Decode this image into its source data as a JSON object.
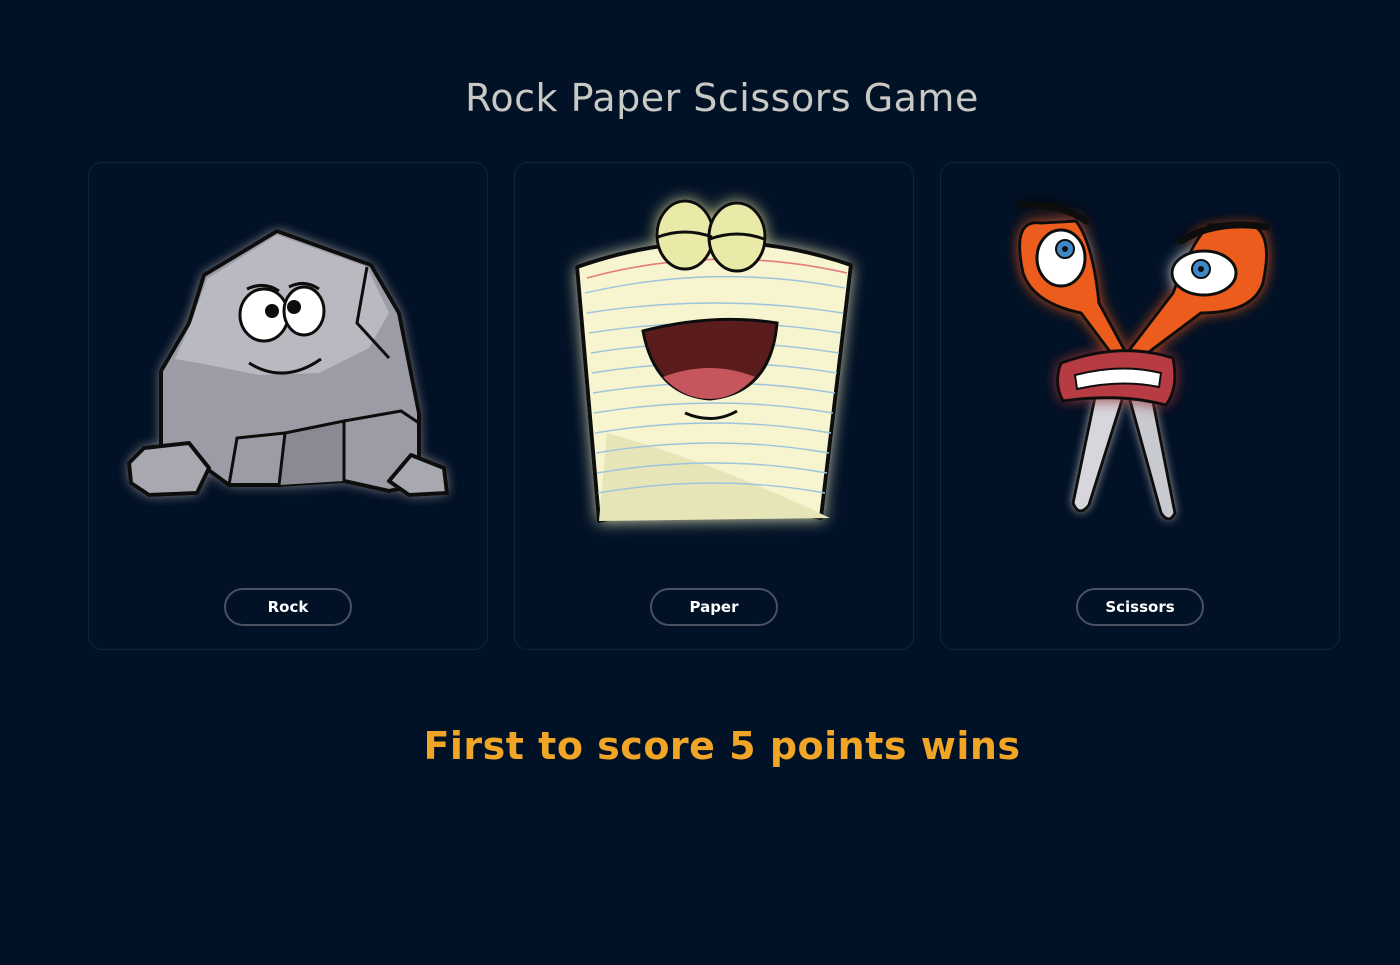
{
  "header": {
    "title": "Rock Paper Scissors Game"
  },
  "choices": [
    {
      "id": "rock",
      "label": "Rock",
      "icon": "rock-character-icon"
    },
    {
      "id": "paper",
      "label": "Paper",
      "icon": "paper-character-icon"
    },
    {
      "id": "scissors",
      "label": "Scissors",
      "icon": "scissors-character-icon"
    }
  ],
  "footer": {
    "rule_text": "First to score 5 points wins"
  },
  "colors": {
    "background": "#011126",
    "title": "#c8c8c4",
    "accent": "#f1a526",
    "button_border": "#4a5160"
  }
}
